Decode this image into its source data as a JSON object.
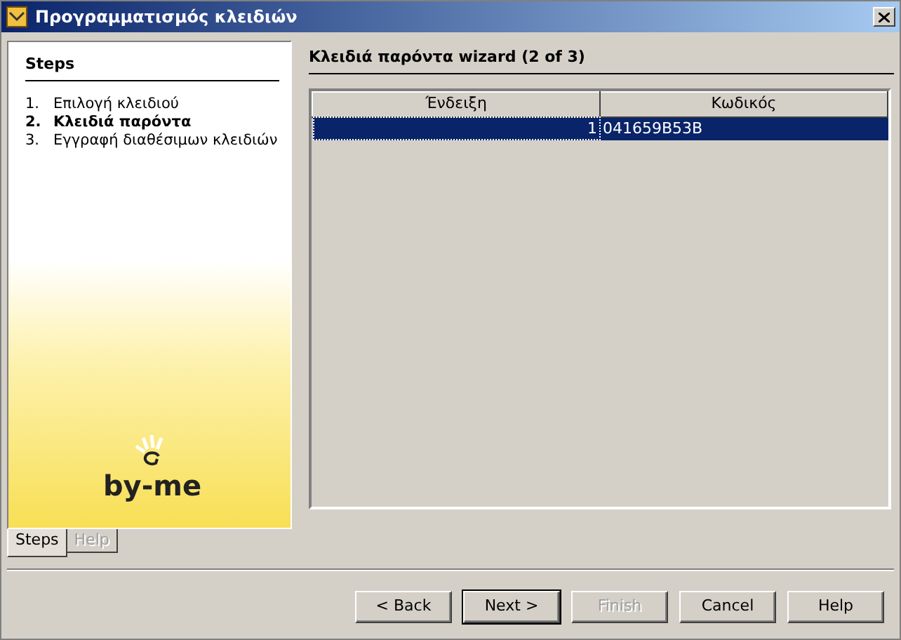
{
  "window": {
    "title": "Προγραμματισμός κλειδιών"
  },
  "steps": {
    "title": "Steps",
    "items": [
      {
        "number": "1.",
        "label": "Επιλογή κλειδιού",
        "selected": false
      },
      {
        "number": "2.",
        "label": "Κλειδιά παρόντα",
        "selected": true
      },
      {
        "number": "3.",
        "label": "Εγγραφή διαθέσιμων κλειδιών",
        "selected": false
      }
    ],
    "logo": "by-me"
  },
  "side_tabs": [
    {
      "label": "Steps",
      "selected": true,
      "disabled": false
    },
    {
      "label": "Help",
      "selected": false,
      "disabled": true
    }
  ],
  "content": {
    "title": "Κλειδιά παρόντα wizard (2 of 3)"
  },
  "table": {
    "columns": [
      "Ένδειξη",
      "Κωδικός"
    ],
    "rows": [
      {
        "cells": [
          "1",
          "041659B53B"
        ],
        "selected": true
      }
    ]
  },
  "buttons": [
    {
      "label": "< Back",
      "disabled": false,
      "default": false
    },
    {
      "label": "Next >",
      "disabled": false,
      "default": true
    },
    {
      "label": "Finish",
      "disabled": true,
      "default": false
    },
    {
      "label": "Cancel",
      "disabled": false,
      "default": false
    },
    {
      "label": "Help",
      "disabled": false,
      "default": false
    }
  ]
}
